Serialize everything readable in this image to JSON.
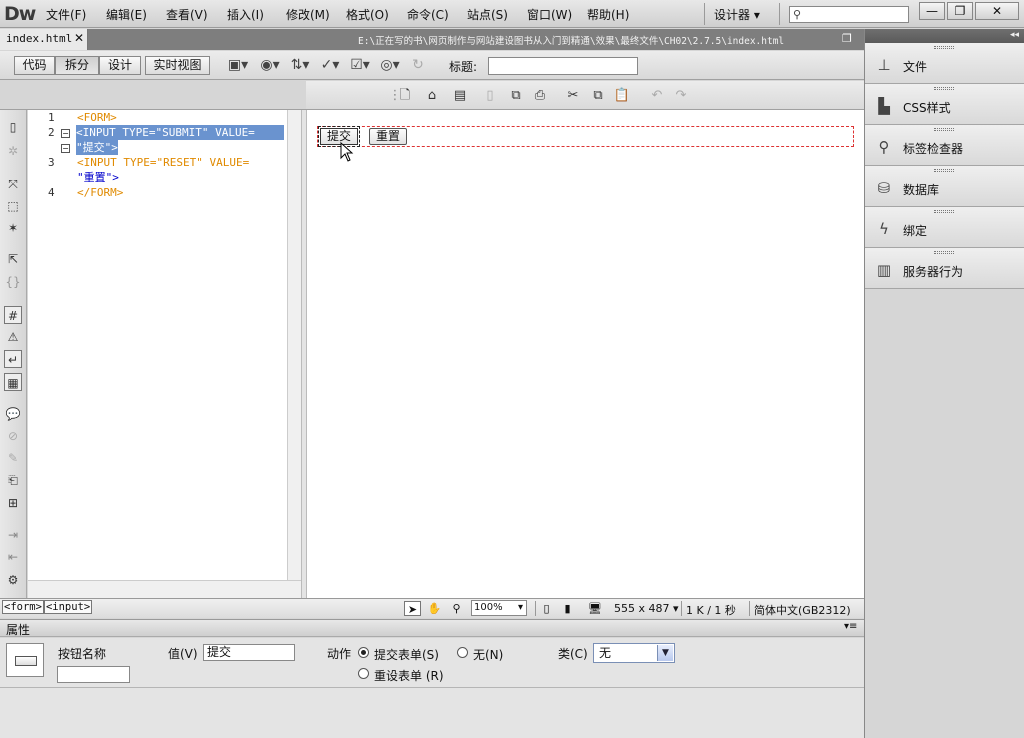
{
  "app": {
    "logo": "Dw",
    "workspace": "设计器 ▾"
  },
  "menu": [
    "文件(F)",
    "编辑(E)",
    "查看(V)",
    "插入(I)",
    "修改(M)",
    "格式(O)",
    "命令(C)",
    "站点(S)",
    "窗口(W)",
    "帮助(H)"
  ],
  "window_controls": {
    "minimize": "—",
    "restore": "❐",
    "close": "✕"
  },
  "document": {
    "tab_name": "index.html",
    "tab_close": "✕",
    "path": "E:\\正在写的书\\网页制作与网站建设图书从入门到精通\\效果\\最终文件\\CH02\\2.7.5\\index.html"
  },
  "doc_toolbar": {
    "views": [
      "代码",
      "拆分",
      "设计",
      "实时视图"
    ],
    "active_view": "拆分",
    "title_label": "标题:",
    "title_value": ""
  },
  "code": {
    "line_numbers": [
      "1",
      "2",
      "3",
      "4"
    ],
    "lines": [
      "<FORM>",
      "<INPUT TYPE=\"SUBMIT\" VALUE=",
      "\"提交\">",
      "<INPUT TYPE=\"RESET\" VALUE=",
      "\"重置\">",
      "</FORM>"
    ]
  },
  "design": {
    "submit_button": "提交",
    "reset_button": "重置"
  },
  "status": {
    "tag_path": [
      "<form>",
      "<input>"
    ],
    "zoom": "100%",
    "dimensions": "555 x 487 ▾",
    "size_time": "1 K / 1 秒",
    "encoding": "简体中文(GB2312)"
  },
  "properties": {
    "title": "属性",
    "menu_icon": "▾≡",
    "button_name_label": "按钮名称",
    "button_name_value": "",
    "value_label": "值(V)",
    "value": "提交",
    "action_label": "动作",
    "action_options": [
      "提交表单(S)",
      "无(N)",
      "重设表单 (R)"
    ],
    "action_selected": "提交表单(S)",
    "class_label": "类(C)",
    "class_value": "无"
  },
  "right_panel": {
    "collapse": "◂◂",
    "items": [
      {
        "label": "文件",
        "icon": "sitemap-icon"
      },
      {
        "label": "CSS样式",
        "icon": "css-icon"
      },
      {
        "label": "标签检查器",
        "icon": "tag-inspector-icon"
      },
      {
        "label": "数据库",
        "icon": "database-icon"
      },
      {
        "label": "绑定",
        "icon": "lightning-icon"
      },
      {
        "label": "服务器行为",
        "icon": "server-icon"
      }
    ]
  }
}
